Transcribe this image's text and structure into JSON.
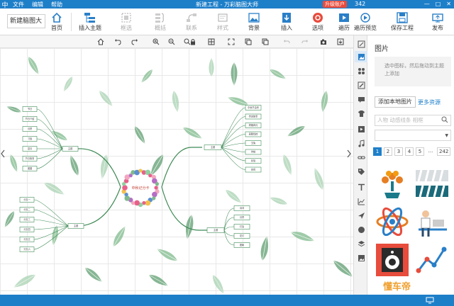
{
  "titlebar": {
    "app_glyph": "中",
    "menu": [
      "文件",
      "编辑",
      "帮助"
    ],
    "title": "新建工程 - 万彩脑图大师",
    "upgrade": "升级账户",
    "account": "342",
    "controls": [
      "—",
      "□",
      "✕"
    ]
  },
  "ribbon": {
    "doc_name": "新建脑图大",
    "buttons": [
      {
        "label": "首页",
        "icon": "home-icon",
        "enabled": true
      },
      {
        "label": "插入主题",
        "icon": "insert-topic-icon",
        "enabled": true
      },
      {
        "label": "框选",
        "icon": "box-select-icon",
        "enabled": false
      },
      {
        "label": "概括",
        "icon": "summary-icon",
        "enabled": false
      },
      {
        "label": "联系",
        "icon": "relation-icon",
        "enabled": false
      },
      {
        "label": "样式",
        "icon": "style-icon",
        "enabled": false
      },
      {
        "label": "背景",
        "icon": "background-icon",
        "enabled": true
      },
      {
        "label": "插入",
        "icon": "insert-icon",
        "enabled": true
      },
      {
        "label": "选项",
        "icon": "options-icon",
        "enabled": true
      },
      {
        "label": "遍历",
        "icon": "traverse-icon",
        "enabled": true
      },
      {
        "label": "遍历预览",
        "icon": "traverse-preview-icon",
        "enabled": true
      },
      {
        "label": "保存工程",
        "icon": "save-icon",
        "enabled": true
      },
      {
        "label": "发布",
        "icon": "publish-icon",
        "enabled": true
      }
    ]
  },
  "quickbar": [
    "home-icon",
    "undo-view-icon",
    "redo-view-icon",
    "zoom-in-icon",
    "zoom-out-icon",
    "search-icon",
    "lock-icon",
    "grid-icon",
    "fullscreen-icon",
    "copy-icon",
    "undo-icon",
    "redo-icon",
    "camera-icon",
    "import-icon"
  ],
  "mindmap": {
    "center": "中秋记分卡",
    "left_branches": [
      {
        "label": "主题",
        "children": [
          "节日",
          "节日介绍",
          "月饼",
          "习俗",
          "赏月",
          "节日故事",
          "团圆"
        ]
      },
      {
        "label": "主题",
        "children": [
          "分支一",
          "分支二",
          "分支三",
          "分支四",
          "分支五",
          "分支六"
        ]
      }
    ],
    "right_branches": [
      {
        "label": "主题",
        "children": [
          "中秋节由来",
          "传说故事",
          "嫦娥奔月",
          "吴刚伐桂",
          "玉兔",
          "传统",
          "民俗",
          "庆祝"
        ]
      },
      {
        "label": "主题",
        "children": [
          "诗词",
          "月饼",
          "灯会",
          "花灯",
          "团聚"
        ]
      }
    ]
  },
  "sidestrip": [
    "edit-icon",
    "image-icon",
    "puzzle-icon",
    "pen-icon",
    "comment-icon",
    "shirt-icon",
    "film-icon",
    "music-icon",
    "link-icon",
    "tag-icon",
    "text-icon",
    "chart-icon",
    "plane-icon",
    "compass-icon",
    "layers-icon",
    "image-box-icon"
  ],
  "panel": {
    "title": "图片",
    "hint": "选中图标，然后拖动到主题上添加",
    "add_button": "添加本地图片",
    "more_link": "更多资源",
    "search_placeholder": "人物 动感线条 相框",
    "pages": [
      "1",
      "2",
      "3",
      "4",
      "5",
      "...",
      "242"
    ],
    "current_page": "1",
    "thumbnails": [
      "tree-icon",
      "bar-stripes-icon",
      "atom-icon",
      "desk-person-icon",
      "speaker-icon",
      "growth-chart-icon"
    ]
  },
  "watermark": "懂车帝",
  "colors": {
    "brand": "#1e7fc9",
    "upgrade": "#e94b3c",
    "leaf": "#8cc29a",
    "branch": "#3e8a55"
  }
}
